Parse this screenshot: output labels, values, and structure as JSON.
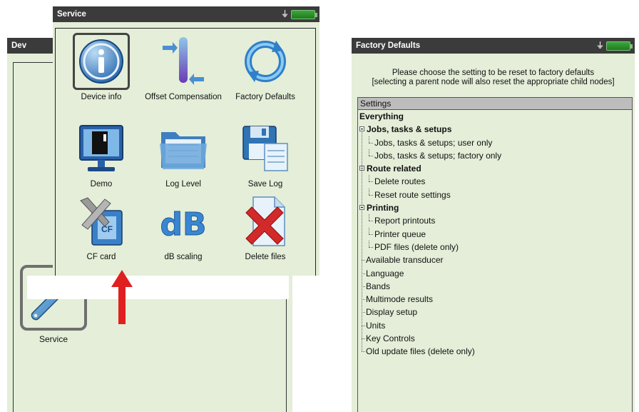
{
  "background_screen": {
    "title": "Dev",
    "service_label": "Service"
  },
  "service_screen": {
    "title": "Service",
    "items": [
      {
        "label": "Device info",
        "icon": "info-icon",
        "selected": true
      },
      {
        "label": "Offset Compensation",
        "icon": "offset-compensation-icon"
      },
      {
        "label": "Factory Defaults",
        "icon": "refresh-icon"
      },
      {
        "label": "Demo",
        "icon": "monitor-icon"
      },
      {
        "label": "Log Level",
        "icon": "folder-icon"
      },
      {
        "label": "Save Log",
        "icon": "floppy-icon"
      },
      {
        "label": "CF card",
        "icon": "cf-card-icon"
      },
      {
        "label": "dB scaling",
        "icon": "db-icon",
        "icon_text": "dB"
      },
      {
        "label": "Delete files",
        "icon": "delete-files-icon"
      }
    ]
  },
  "factory_defaults_screen": {
    "title": "Factory Defaults",
    "instruction_line1": "Please choose the setting to be reset to factory defaults",
    "instruction_line2": "[selecting a parent node will also reset the appropriate child nodes]",
    "list_header": "Settings",
    "tree": [
      {
        "label": "Everything",
        "level": 0,
        "bold": true
      },
      {
        "label": "Jobs, tasks & setups",
        "level": 1,
        "bold": true,
        "expanded": true
      },
      {
        "label": "Jobs, tasks & setups; user only",
        "level": 2
      },
      {
        "label": "Jobs, tasks & setups; factory only",
        "level": 2
      },
      {
        "label": "Route related",
        "level": 1,
        "bold": true,
        "expanded": true
      },
      {
        "label": "Delete routes",
        "level": 2
      },
      {
        "label": "Reset route settings",
        "level": 2
      },
      {
        "label": "Printing",
        "level": 1,
        "bold": true,
        "expanded": true
      },
      {
        "label": "Report printouts",
        "level": 2
      },
      {
        "label": "Printer queue",
        "level": 2
      },
      {
        "label": "PDF files (delete only)",
        "level": 2
      },
      {
        "label": "Available transducer",
        "level": 1
      },
      {
        "label": "Language",
        "level": 1
      },
      {
        "label": "Bands",
        "level": 1
      },
      {
        "label": "Multimode results",
        "level": 1
      },
      {
        "label": "Display setup",
        "level": 1
      },
      {
        "label": "Units",
        "level": 1
      },
      {
        "label": "Key Controls",
        "level": 1
      },
      {
        "label": "Old update files (delete only)",
        "level": 1
      }
    ]
  },
  "colors": {
    "screen_bg": "#e4eed8",
    "titlebar_bg": "#3b3b3b",
    "arrow": "#e02020",
    "battery": "#2e8b2e"
  }
}
